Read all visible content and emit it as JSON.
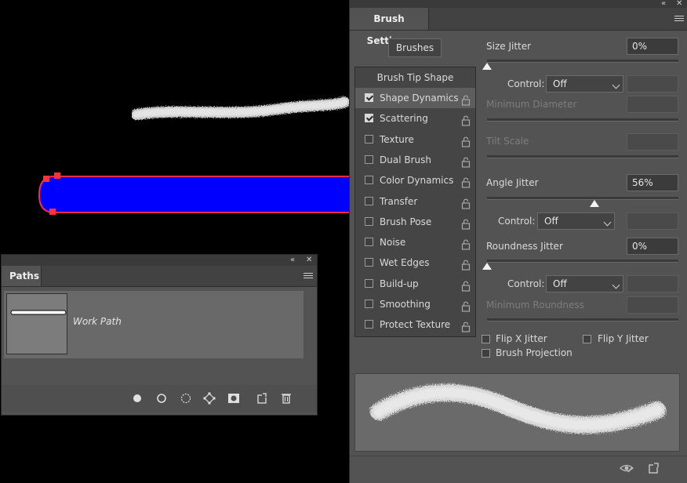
{
  "colors": {
    "canvas_bg": "#000000",
    "path_fill": "#0000ff",
    "path_outline": "#ff2a4a",
    "anchor": "#ff3333",
    "panel_bg": "#535353",
    "list_bg": "#454545",
    "selected_bg": "#5d5d5d",
    "preview_bg": "#6a6a6a"
  },
  "paths_panel": {
    "tab": "Paths",
    "path_name": "Work Path",
    "bottom_icons": [
      "fill-path-icon",
      "stroke-path-icon",
      "load-selection-icon",
      "make-work-path-icon",
      "add-mask-icon",
      "new-path-icon",
      "trash-icon"
    ]
  },
  "brush_settings": {
    "tab": "Brush Settings",
    "brushes_button": "Brushes",
    "options_header": "Brush Tip Shape",
    "options": [
      {
        "label": "Shape Dynamics",
        "checked": true,
        "selected": true
      },
      {
        "label": "Scattering",
        "checked": true,
        "selected": false
      },
      {
        "label": "Texture",
        "checked": false,
        "selected": false
      },
      {
        "label": "Dual Brush",
        "checked": false,
        "selected": false
      },
      {
        "label": "Color Dynamics",
        "checked": false,
        "selected": false
      },
      {
        "label": "Transfer",
        "checked": false,
        "selected": false
      },
      {
        "label": "Brush Pose",
        "checked": false,
        "selected": false
      },
      {
        "label": "Noise",
        "checked": false,
        "selected": false
      },
      {
        "label": "Wet Edges",
        "checked": false,
        "selected": false
      },
      {
        "label": "Build-up",
        "checked": false,
        "selected": false
      },
      {
        "label": "Smoothing",
        "checked": false,
        "selected": false
      },
      {
        "label": "Protect Texture",
        "checked": false,
        "selected": false
      }
    ],
    "size_jitter": {
      "label": "Size Jitter",
      "value": "0%",
      "level": 0
    },
    "control1": {
      "label": "Control:",
      "value": "Off"
    },
    "minimum_diameter": {
      "label": "Minimum Diameter"
    },
    "tilt_scale": {
      "label": "Tilt Scale"
    },
    "angle_jitter": {
      "label": "Angle Jitter",
      "value": "56%",
      "level": 0.56
    },
    "control2": {
      "label": "Control:",
      "value": "Off"
    },
    "roundness_jitter": {
      "label": "Roundness Jitter",
      "value": "0%",
      "level": 0
    },
    "control3": {
      "label": "Control:",
      "value": "Off"
    },
    "minimum_roundness": {
      "label": "Minimum Roundness"
    },
    "flip_x": {
      "label": "Flip X Jitter",
      "checked": false
    },
    "flip_y": {
      "label": "Flip Y Jitter",
      "checked": false
    },
    "brush_projection": {
      "label": "Brush Projection",
      "checked": false
    }
  }
}
